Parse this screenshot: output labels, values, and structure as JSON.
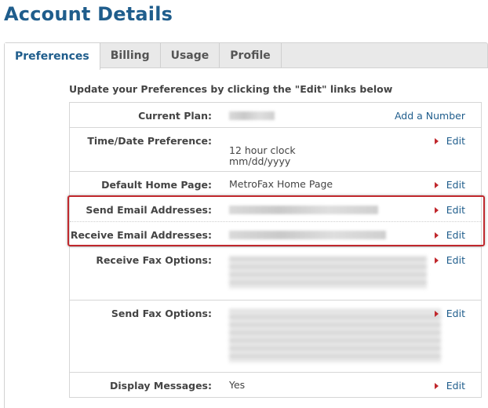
{
  "page": {
    "title": "Account Details"
  },
  "tabs": [
    {
      "label": "Preferences",
      "active": true
    },
    {
      "label": "Billing",
      "active": false
    },
    {
      "label": "Usage",
      "active": false
    },
    {
      "label": "Profile",
      "active": false
    }
  ],
  "intro": "Update your Preferences by clicking the \"Edit\" links below",
  "rows": {
    "current_plan": {
      "label": "Current Plan:",
      "action": "Add a Number"
    },
    "time_date": {
      "label": "Time/Date Preference:",
      "value_line1": "12 hour clock",
      "value_line2": "mm/dd/yyyy",
      "action": "Edit"
    },
    "home_page": {
      "label": "Default Home Page:",
      "value": "MetroFax Home Page",
      "action": "Edit"
    },
    "send_email": {
      "label": "Send Email Addresses:",
      "action": "Edit"
    },
    "receive_email": {
      "label": "Receive Email Addresses:",
      "action": "Edit"
    },
    "receive_fax": {
      "label": "Receive Fax Options:",
      "action": "Edit"
    },
    "send_fax": {
      "label": "Send Fax Options:",
      "action": "Edit"
    },
    "display_messages": {
      "label": "Display Messages:",
      "value": "Yes",
      "action": "Edit"
    }
  },
  "colors": {
    "title": "#1f5d8c",
    "link": "#1f5d8c",
    "caret": "#c0282d",
    "highlight": "#c0282d"
  }
}
